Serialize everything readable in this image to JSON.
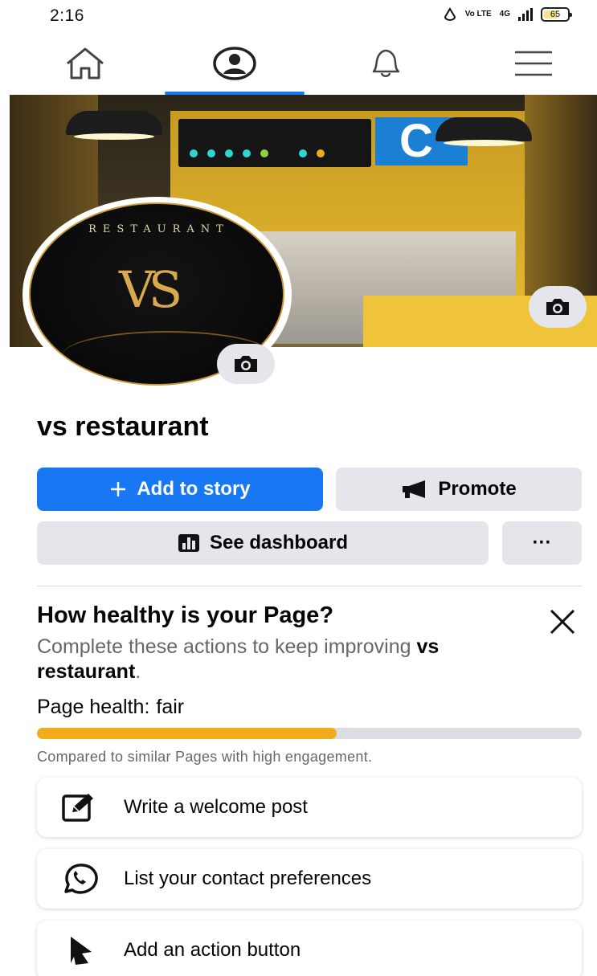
{
  "status_bar": {
    "time": "2:16",
    "volte": "Vo LTE",
    "network": "4G",
    "battery": "65",
    "battery_level": 0.65
  },
  "nav": {
    "items": [
      {
        "name": "home",
        "icon": "home-icon"
      },
      {
        "name": "profile",
        "icon": "profile-icon",
        "active": true
      },
      {
        "name": "notifications",
        "icon": "bell-icon"
      },
      {
        "name": "menu",
        "icon": "hamburger-menu-icon"
      }
    ],
    "accent": "#1877f2"
  },
  "cover": {
    "camera_icon": "camera-icon"
  },
  "profile": {
    "picture_word": "RESTAURANT",
    "picture_monogram": "VS",
    "camera_icon": "camera-icon"
  },
  "page": {
    "name": "vs restaurant"
  },
  "actions": {
    "add_story": "Add to story",
    "promote": "Promote",
    "dashboard": "See dashboard",
    "more": "···",
    "primary_color": "#1877f2",
    "secondary_color": "#e4e6eb"
  },
  "health": {
    "title": "How healthy is your Page?",
    "desc_prefix": "Complete these actions to keep improving ",
    "desc_bold": "vs restaurant",
    "desc_suffix": ".",
    "status_label": "Page health:",
    "status_value": "fair",
    "progress_fraction": 0.55,
    "progress_color": "#f0ac1b",
    "compare_text": "Compared to similar Pages with high engagement.",
    "items": [
      {
        "label": "Write a welcome post",
        "icon": "edit-post-icon"
      },
      {
        "label": "List your contact preferences",
        "icon": "whatsapp-icon"
      },
      {
        "label": "Add an action button",
        "icon": "cursor-pointer-icon"
      }
    ]
  }
}
